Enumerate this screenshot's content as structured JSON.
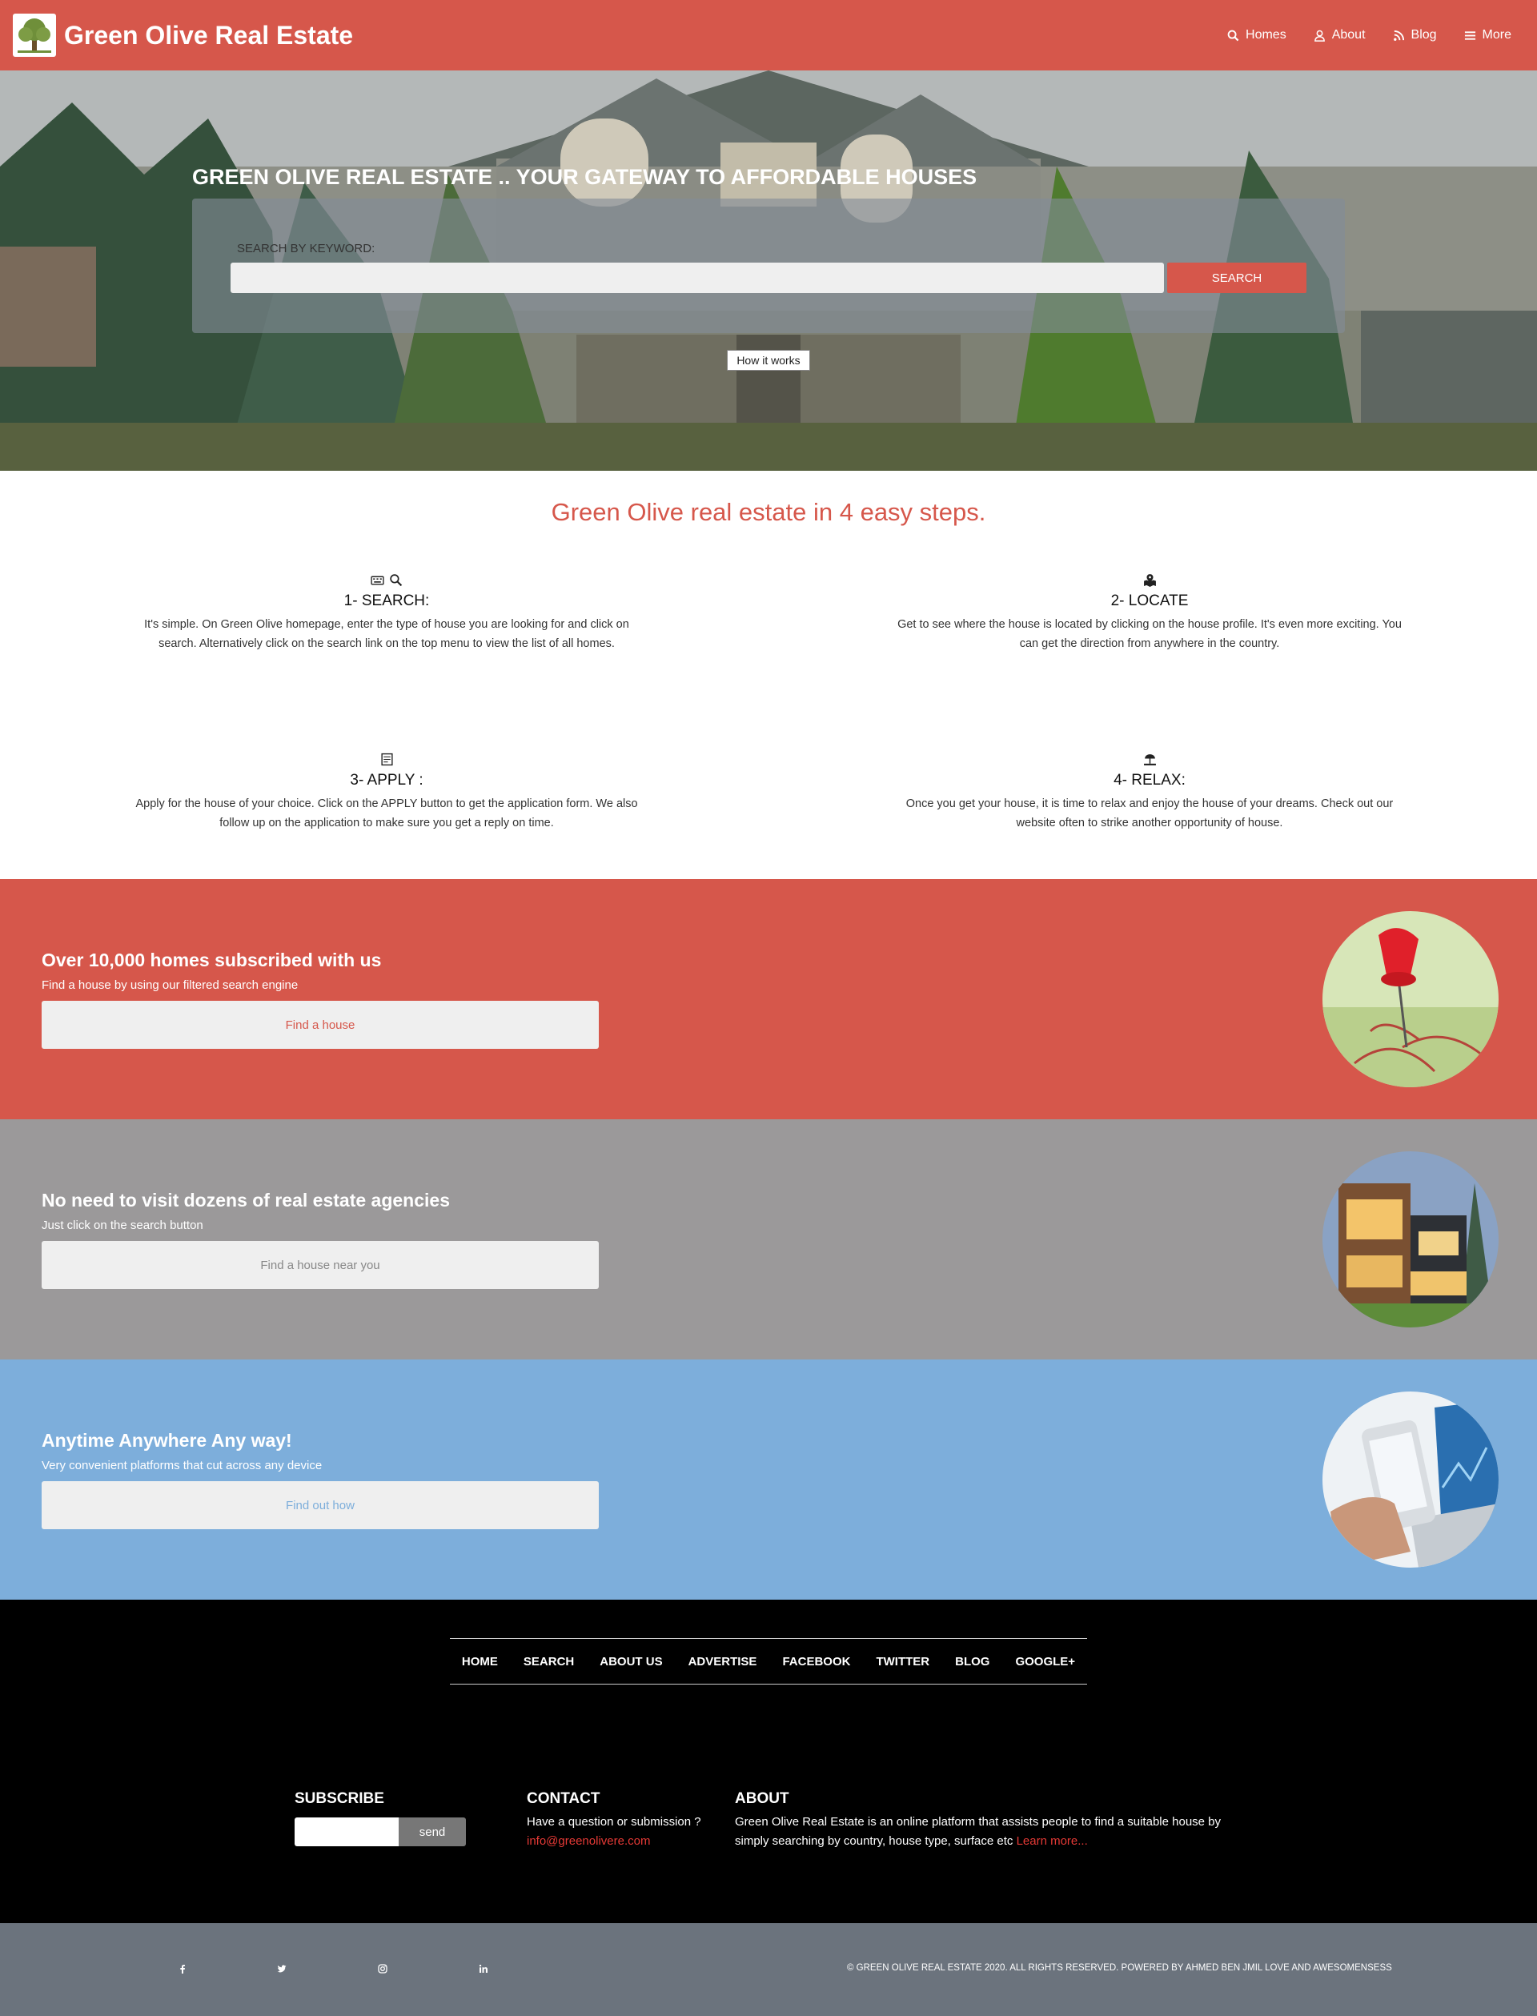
{
  "nav": {
    "brand": "Green Olive Real Estate",
    "links": [
      "Homes",
      "About",
      "Blog",
      "More"
    ]
  },
  "hero": {
    "title": "GREEN OLIVE REAL ESTATE .. YOUR GATEWAY TO AFFORDABLE HOUSES",
    "search_label": "SEARCH BY KEYWORD:",
    "search_value": "",
    "search_button": "SEARCH",
    "how_button": "How it works"
  },
  "steps": {
    "title": "Green Olive real estate in 4 easy steps.",
    "items": [
      {
        "title": "1- SEARCH:",
        "text": "It's simple. On Green Olive homepage, enter the type of house you are looking for and click on search. Alternatively click on the search link on the top menu to view the list of all homes."
      },
      {
        "title": "2- LOCATE",
        "text": "Get to see where the house is located by clicking on the house profile. It's even more exciting. You can get the direction from anywhere in the country."
      },
      {
        "title": "3- APPLY :",
        "text": "Apply for the house of your choice. Click on the APPLY button to get the application form. We also follow up on the application to make sure you get a reply on time."
      },
      {
        "title": "4- RELAX:",
        "text": "Once you get your house, it is time to relax and enjoy the house of your dreams. Check out our website often to strike another opportunity of house."
      }
    ]
  },
  "bands": [
    {
      "title": "Over 10,000 homes subscribed with us",
      "subtitle": "Find a house by using our filtered search engine",
      "button": "Find a house",
      "color": "#d6574b"
    },
    {
      "title": "No need to visit dozens of real estate agencies",
      "subtitle": "Just click on the search button",
      "button": "Find a house near you",
      "color": "#9b999a"
    },
    {
      "title": "Anytime Anywhere Any way!",
      "subtitle": "Very convenient platforms that cut across any device",
      "button": "Find out how",
      "color": "#7daedb"
    }
  ],
  "footer": {
    "nav": [
      "HOME",
      "SEARCH",
      "ABOUT US",
      "ADVERTISE",
      "FACEBOOK",
      "TWITTER",
      "BLOG",
      "GOOGLE+"
    ],
    "subscribe_title": "SUBSCRIBE",
    "subscribe_value": "",
    "send": "send",
    "contact_title": "CONTACT",
    "contact_text": "Have a question or submission ?",
    "contact_email": "info@greenolivere.com",
    "about_title": "ABOUT",
    "about_text": "Green Olive Real Estate is an online platform that assists people to find a suitable house by simply searching by country, house type, surface etc",
    "about_link": "Learn more...",
    "copyright": "© GREEN OLIVE REAL ESTATE 2020. ALL RIGHTS RESERVED. POWERED BY AHMED BEN JMIL LOVE AND AWESOMENSESS"
  }
}
